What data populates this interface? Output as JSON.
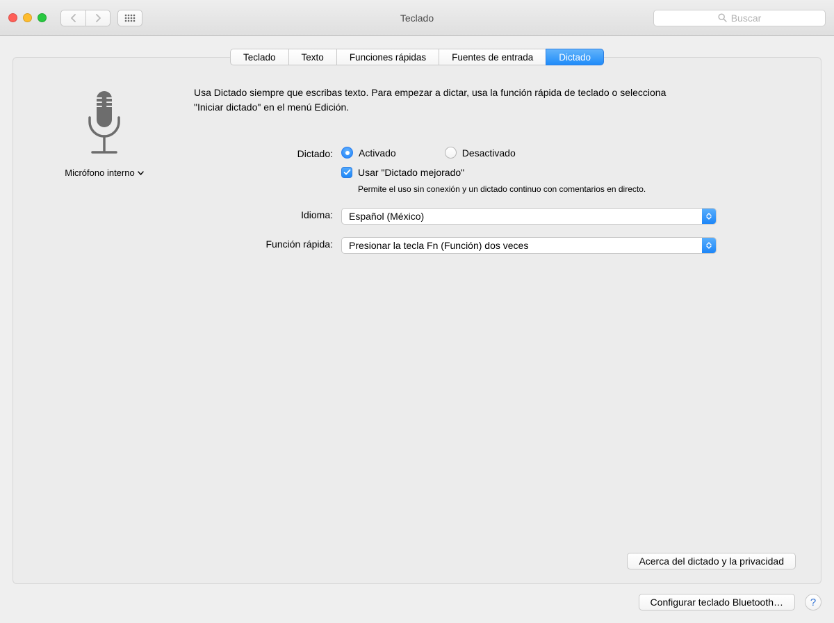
{
  "window": {
    "title": "Teclado",
    "search_placeholder": "Buscar"
  },
  "tabs": [
    {
      "label": "Teclado"
    },
    {
      "label": "Texto"
    },
    {
      "label": "Funciones rápidas"
    },
    {
      "label": "Fuentes de entrada"
    },
    {
      "label": "Dictado"
    }
  ],
  "mic": {
    "label": "Micrófono interno"
  },
  "description": "Usa Dictado siempre que escribas texto. Para empezar a dictar, usa la función rápida de teclado o selecciona \"Iniciar dictado\" en el menú Edición.",
  "labels": {
    "dictado": "Dictado:",
    "idioma": "Idioma:",
    "funcion_rapida": "Función rápida:"
  },
  "dictado": {
    "activado": "Activado",
    "desactivado": "Desactivado",
    "mejorado_label": "Usar \"Dictado mejorado\"",
    "mejorado_sub": "Permite el uso sin conexión y un dictado continuo con comentarios en directo."
  },
  "idioma_value": "Español (México)",
  "shortcut_value": "Presionar la tecla Fn (Función) dos veces",
  "buttons": {
    "privacy": "Acerca del dictado y la privacidad",
    "bluetooth": "Configurar teclado Bluetooth…",
    "help": "?"
  }
}
